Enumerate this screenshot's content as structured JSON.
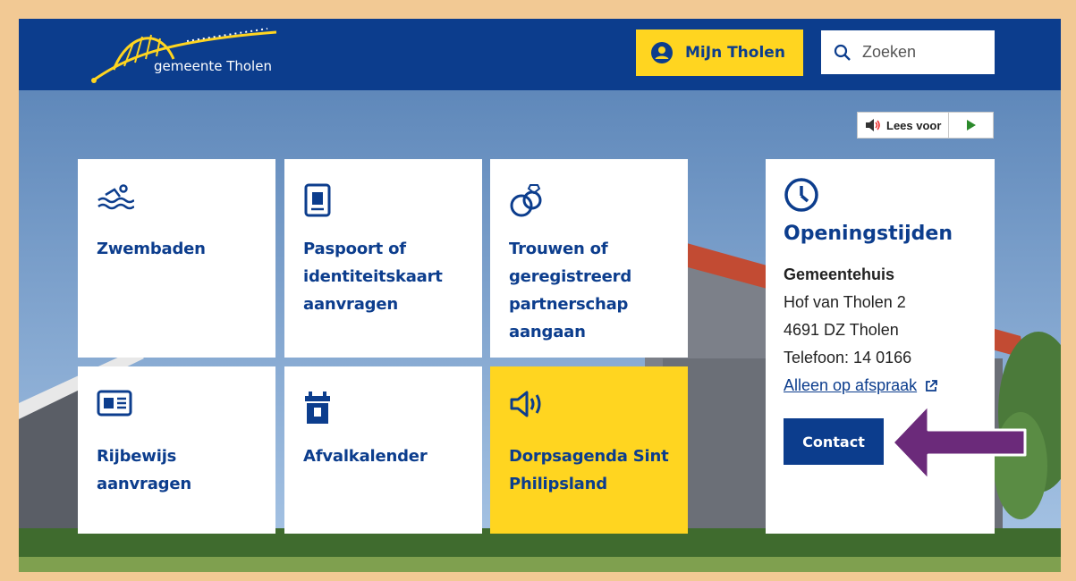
{
  "header": {
    "logo_text": "gemeente Tholen",
    "mijn_label": "MiJn Tholen",
    "search_placeholder": "Zoeken"
  },
  "lees_voor": {
    "label": "Lees voor"
  },
  "tiles": [
    {
      "label": "Zwembaden",
      "icon": "swimming-icon"
    },
    {
      "label": "Paspoort of identiteitskaart aanvragen",
      "icon": "passport-icon"
    },
    {
      "label": "Trouwen of geregistreerd partnerschap aangaan",
      "icon": "rings-icon"
    },
    {
      "label": "Rijbewijs aanvragen",
      "icon": "drivers-license-icon"
    },
    {
      "label": "Afvalkalender",
      "icon": "waste-bin-icon"
    },
    {
      "label": "Dorpsagenda Sint Philipsland",
      "icon": "megaphone-icon"
    }
  ],
  "opening": {
    "title": "Openingstijden",
    "place": "Gemeentehuis",
    "address1": "Hof van Tholen 2",
    "address2": "4691 DZ Tholen",
    "phone": "Telefoon: 14 0166",
    "appointment": "Alleen op afspraak",
    "contact_label": "Contact"
  },
  "colors": {
    "brand_blue": "#0c3d8d",
    "brand_yellow": "#ffd520",
    "annotation_arrow": "#6b2a7a"
  }
}
